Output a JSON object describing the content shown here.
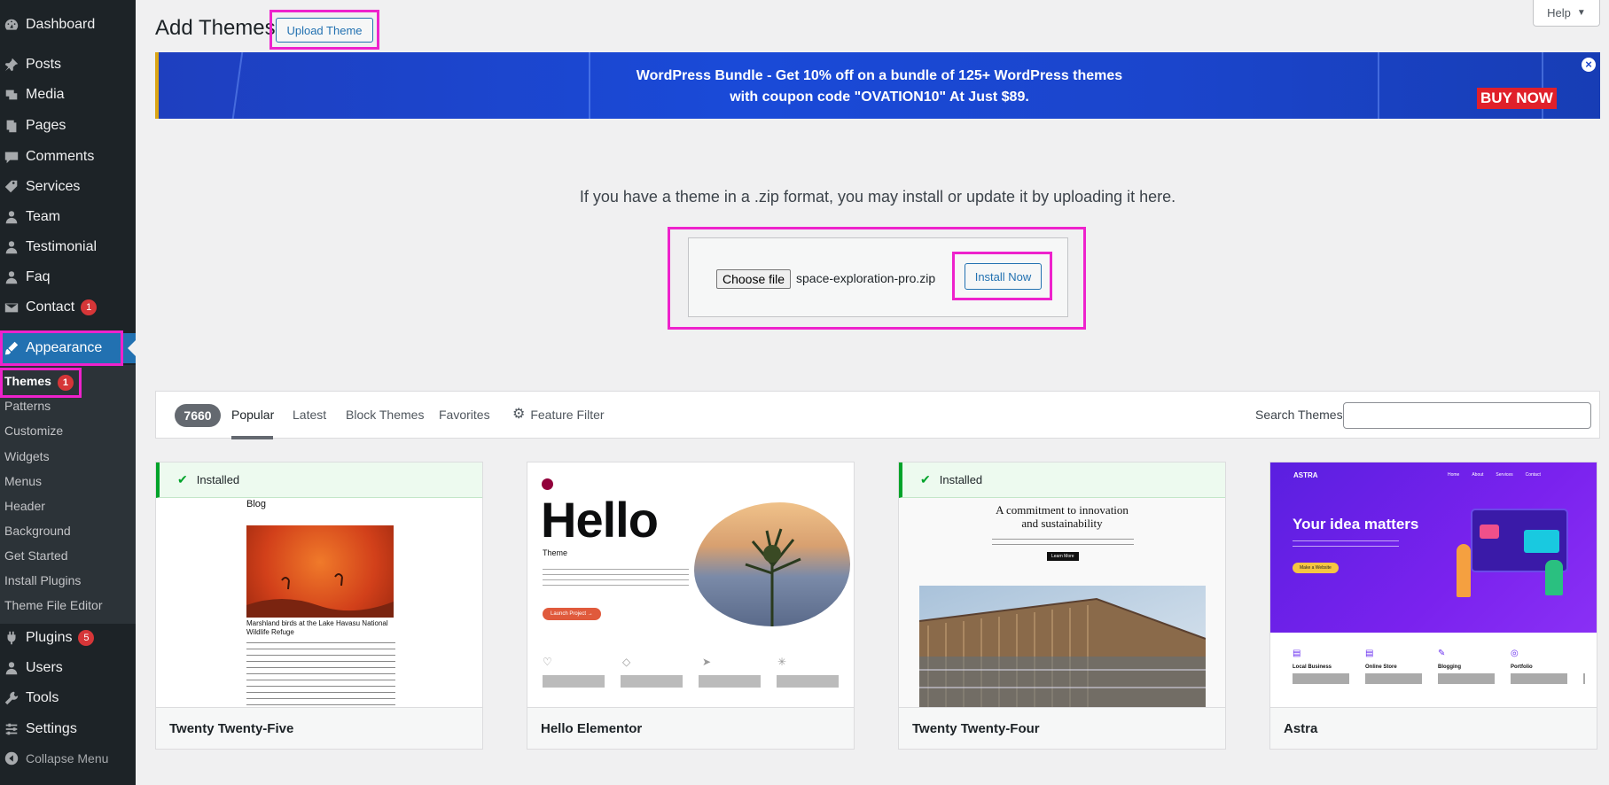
{
  "sidebar": {
    "items": [
      {
        "label": "Dashboard",
        "icon": "dashboard-icon"
      },
      {
        "label": "Posts",
        "icon": "pin-icon"
      },
      {
        "label": "Media",
        "icon": "media-icon"
      },
      {
        "label": "Pages",
        "icon": "pages-icon"
      },
      {
        "label": "Comments",
        "icon": "comment-icon"
      },
      {
        "label": "Services",
        "icon": "tag-icon"
      },
      {
        "label": "Team",
        "icon": "users-icon"
      },
      {
        "label": "Testimonial",
        "icon": "users-icon"
      },
      {
        "label": "Faq",
        "icon": "users-icon"
      },
      {
        "label": "Contact",
        "icon": "mail-icon",
        "badge": "1"
      },
      {
        "label": "Appearance",
        "icon": "brush-icon"
      },
      {
        "label": "Plugins",
        "icon": "plug-icon",
        "badge": "5"
      },
      {
        "label": "Users",
        "icon": "user-icon"
      },
      {
        "label": "Tools",
        "icon": "wrench-icon"
      },
      {
        "label": "Settings",
        "icon": "settings-icon"
      },
      {
        "label": "Collapse Menu",
        "icon": "collapse-icon"
      }
    ],
    "submenu": [
      {
        "label": "Themes",
        "badge": "1"
      },
      {
        "label": "Patterns"
      },
      {
        "label": "Customize"
      },
      {
        "label": "Widgets"
      },
      {
        "label": "Menus"
      },
      {
        "label": "Header"
      },
      {
        "label": "Background"
      },
      {
        "label": "Get Started"
      },
      {
        "label": "Install Plugins"
      },
      {
        "label": "Theme File Editor"
      }
    ]
  },
  "header": {
    "title": "Add Themes",
    "upload_label": "Upload Theme",
    "help_label": "Help"
  },
  "banner": {
    "line1": "WordPress Bundle - Get 10% off on a bundle of 125+ WordPress themes",
    "line2": "with coupon code \"OVATION10\" At Just $89.",
    "buy_now": "BUY NOW",
    "close": "×"
  },
  "upload": {
    "description": "If you have a theme in a .zip format, you may install or update it by uploading it here.",
    "choose_file": "Choose file",
    "file_name": "space-exploration-pro.zip",
    "install_label": "Install Now"
  },
  "filter": {
    "count": "7660",
    "tabs": [
      "Popular",
      "Latest",
      "Block Themes",
      "Favorites",
      "Feature Filter"
    ],
    "search_label": "Search Themes",
    "search_value": ""
  },
  "themes": [
    {
      "name": "Twenty Twenty-Five",
      "installed": "Installed",
      "preview": {
        "heading": "Blog",
        "caption": "Marshland birds at the Lake Havasu National Wildlife Refuge"
      }
    },
    {
      "name": "Hello Elementor",
      "preview": {
        "heading": "Hello",
        "subheading": "Theme",
        "button": "Launch Project →"
      }
    },
    {
      "name": "Twenty Twenty-Four",
      "installed": "Installed",
      "preview": {
        "heading_line1": "A commitment to innovation",
        "heading_line2": "and sustainability",
        "button": "Learn More"
      }
    },
    {
      "name": "Astra",
      "preview": {
        "logo": "ASTRA",
        "nav": [
          "Home",
          "About",
          "Services",
          "Contact"
        ],
        "heading": "Your idea matters",
        "button": "Make a Website",
        "features": [
          "Local Business",
          "Online Store",
          "Blogging",
          "Portfolio"
        ]
      }
    }
  ],
  "colors": {
    "sidebar_bg": "#1d2327",
    "accent": "#2271b1",
    "highlight": "#ee22cc",
    "badge": "#d63638",
    "installed_green": "#00a32a"
  }
}
